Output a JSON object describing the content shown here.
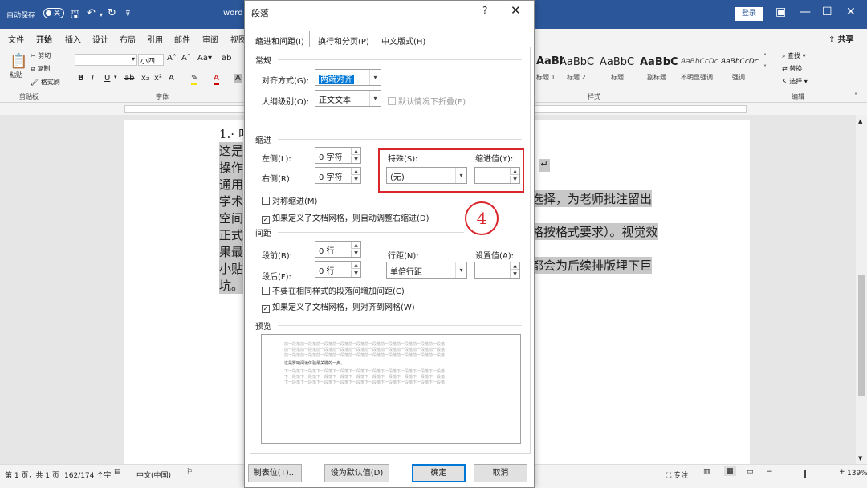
{
  "titlebar": {
    "autosave_label": "自动保存",
    "autosave_state": "关",
    "doc_title": "word",
    "login_label": "登录"
  },
  "ribbon_tabs": [
    "文件",
    "开始",
    "插入",
    "设计",
    "布局",
    "引用",
    "邮件",
    "审阅",
    "视图"
  ],
  "active_tab": "开始",
  "share_label": "共享",
  "ribbon": {
    "paste_label": "粘贴",
    "cut_label": "剪切",
    "copy_label": "复制",
    "format_painter_label": "格式刷",
    "clipboard_group": "剪贴板",
    "font_size": "小四",
    "font_group": "字体",
    "styles": [
      {
        "sample": "AaBl",
        "name": "标题 1"
      },
      {
        "sample": "AaBbC",
        "name": "标题 2"
      },
      {
        "sample": "AaBbC",
        "name": "标题"
      },
      {
        "sample": "AaBbC",
        "name": "副标题"
      },
      {
        "sample": "AaBbCcDc",
        "name": "不明显强调"
      },
      {
        "sample": "AaBbCcDc",
        "name": "强调"
      }
    ],
    "styles_group": "样式",
    "find_label": "查找",
    "replace_label": "替换",
    "select_label": "选择",
    "editing_group": "编辑"
  },
  "document": {
    "left_lines": [
      "1.· 叫",
      "这是",
      "操作",
      "通用",
      "学术",
      "空间",
      "正式",
      "果最",
      "小贴",
      "坑。"
    ],
    "right_lines": [
      "选择，为老师批注留出",
      "格按格式要求）。视觉效",
      "都会为后续排版埋下巨"
    ]
  },
  "statusbar": {
    "page_info": "第 1 页，共 1 页",
    "word_count": "162/174 个字",
    "language": "中文(中国)",
    "focus_label": "专注",
    "zoom": "139%"
  },
  "dialog": {
    "title": "段落",
    "tabs": [
      "缩进和间距(I)",
      "换行和分页(P)",
      "中文版式(H)"
    ],
    "general": {
      "section": "常规",
      "alignment_label": "对齐方式(G):",
      "alignment_value": "两端对齐",
      "outline_label": "大纲级别(O):",
      "outline_value": "正文文本",
      "collapsed_label": "默认情况下折叠(E)"
    },
    "indent": {
      "section": "缩进",
      "left_label": "左侧(L):",
      "left_value": "0 字符",
      "right_label": "右侧(R):",
      "right_value": "0 字符",
      "special_label": "特殊(S):",
      "special_value": "(无)",
      "by_label": "缩进值(Y):",
      "by_value": "",
      "mirror_label": "对称缩进(M)",
      "auto_adjust_label": "如果定义了文档网格，则自动调整右缩进(D)"
    },
    "spacing": {
      "section": "间距",
      "before_label": "段前(B):",
      "before_value": "0 行",
      "after_label": "段后(F):",
      "after_value": "0 行",
      "line_label": "行距(N):",
      "line_value": "单倍行距",
      "at_label": "设置值(A):",
      "at_value": "",
      "no_space_label": "不要在相同样式的段落间增加间距(C)",
      "snap_grid_label": "如果定义了文档网格，则对齐到网格(W)"
    },
    "preview": {
      "section": "预览",
      "prev_line": "前一段落前一段落前一段落前一段落前一段落前一段落前一段落前一段落前一段落前一段落",
      "sample_line": "这是影响阅读体验最关键的一步。",
      "next_line": "下一段落下一段落下一段落下一段落下一段落下一段落下一段落下一段落下一段落下一段落"
    },
    "buttons": {
      "tabs": "制表位(T)...",
      "set_default": "设为默认值(D)",
      "ok": "确定",
      "cancel": "取消"
    },
    "annotation_number": "4"
  }
}
